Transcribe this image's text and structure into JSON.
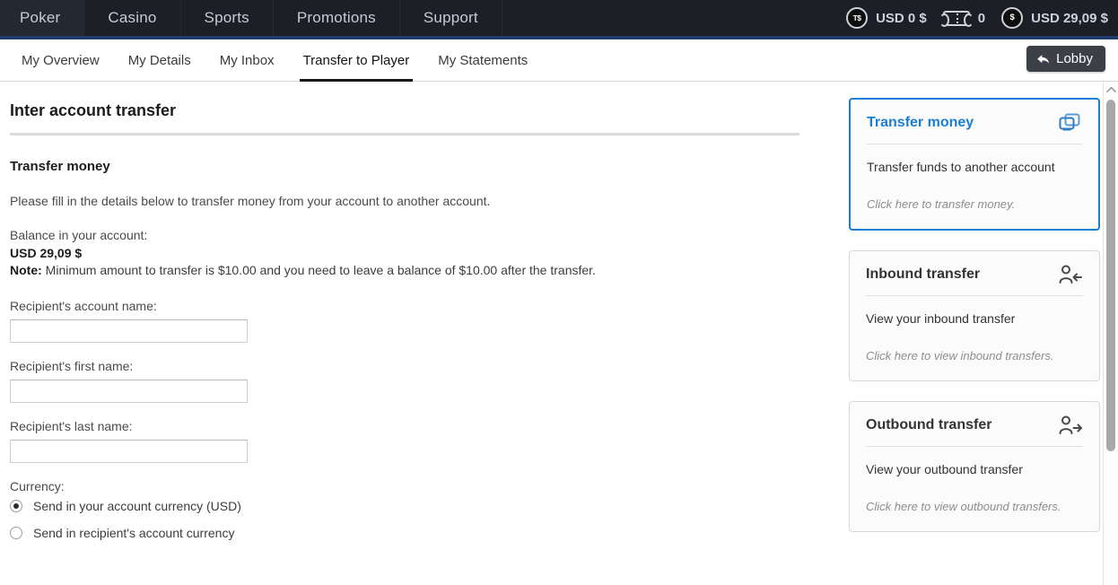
{
  "topnav": {
    "items": [
      {
        "label": "Poker",
        "name": "nav-poker"
      },
      {
        "label": "Casino",
        "name": "nav-casino"
      },
      {
        "label": "Sports",
        "name": "nav-sports"
      },
      {
        "label": "Promotions",
        "name": "nav-promotions"
      },
      {
        "label": "Support",
        "name": "nav-support"
      }
    ],
    "balances": {
      "tournament_coin_glyph": "T$",
      "tournament_amount": "USD 0 $",
      "ticket_count": "0",
      "cash_coin_glyph": "$",
      "cash_amount": "USD 29,09 $"
    },
    "accent_color": "#1d3c6b",
    "background_color": "#1c1f26"
  },
  "tabbar": {
    "tabs": [
      {
        "label": "My Overview",
        "active": false
      },
      {
        "label": "My Details",
        "active": false
      },
      {
        "label": "My Inbox",
        "active": false
      },
      {
        "label": "Transfer to Player",
        "active": true
      },
      {
        "label": "My Statements",
        "active": false
      }
    ],
    "lobby_button": "Lobby"
  },
  "main": {
    "page_title": "Inter account transfer",
    "section_title": "Transfer money",
    "intro": "Please fill in the details below to transfer money from your account to another account.",
    "balance_label": "Balance in your account:",
    "balance_value": "USD 29,09 $",
    "note_prefix": "Note:",
    "note_text": " Minimum amount to transfer is $10.00 and you need to leave a balance of $10.00 after the transfer.",
    "fields": [
      {
        "label": "Recipient's account name:",
        "value": "",
        "name": "recipient-account-name-input"
      },
      {
        "label": "Recipient's first name:",
        "value": "",
        "name": "recipient-first-name-input"
      },
      {
        "label": "Recipient's last name:",
        "value": "",
        "name": "recipient-last-name-input"
      }
    ],
    "currency_label": "Currency:",
    "currency_options": [
      {
        "label": "Send in your account currency (USD)",
        "selected": true
      },
      {
        "label": "Send in recipient's account currency",
        "selected": false
      }
    ]
  },
  "aside": {
    "cards": [
      {
        "title": "Transfer money",
        "desc": "Transfer funds to another account",
        "hint": "Click here to transfer money.",
        "icon": "transfer-money-icon",
        "active": true,
        "accent_color": "#1a7fd4"
      },
      {
        "title": "Inbound transfer",
        "desc": "View your inbound transfer",
        "hint": "Click here to view inbound transfers.",
        "icon": "user-inbound-icon",
        "active": false
      },
      {
        "title": "Outbound transfer",
        "desc": "View your outbound transfer",
        "hint": "Click here to view outbound transfers.",
        "icon": "user-outbound-icon",
        "active": false
      }
    ]
  }
}
